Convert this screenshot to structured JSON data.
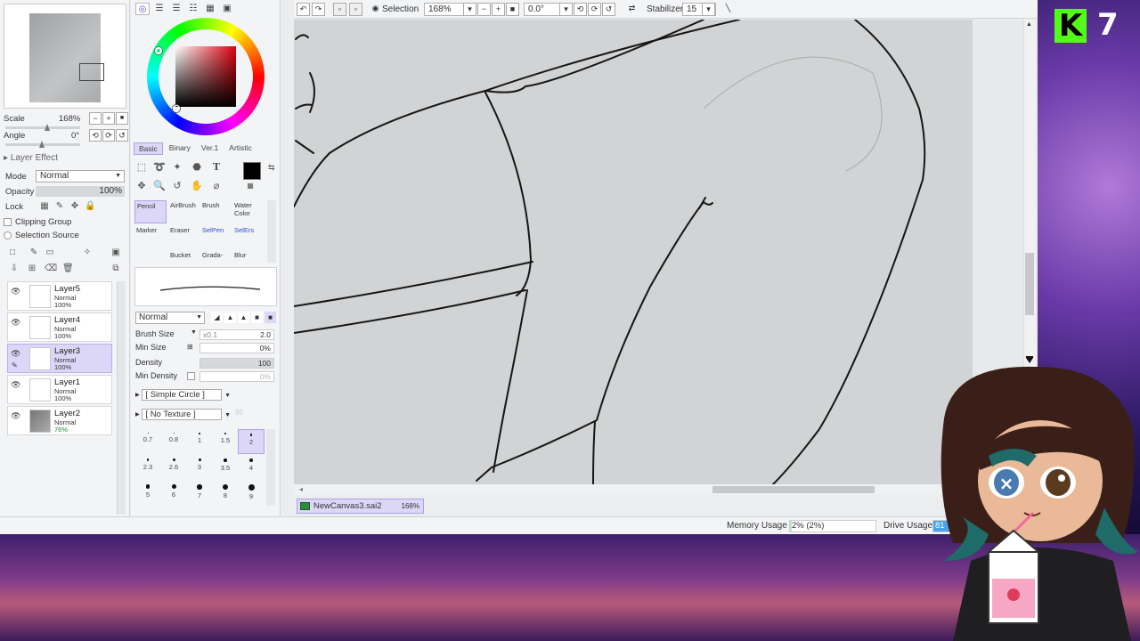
{
  "navigator": {
    "scale_label": "Scale",
    "scale_value": "168%",
    "angle_label": "Angle",
    "angle_value": "0°"
  },
  "layer_panel": {
    "effect_label": "Layer Effect",
    "mode_label": "Mode",
    "mode_value": "Normal",
    "opacity_label": "Opacity",
    "opacity_value": "100%",
    "lock_label": "Lock",
    "clipping_group": "Clipping Group",
    "selection_source": "Selection Source",
    "layers": [
      {
        "name": "Layer5",
        "mode": "Normal",
        "opacity": "100%"
      },
      {
        "name": "Layer4",
        "mode": "Normal",
        "opacity": "100%"
      },
      {
        "name": "Layer3",
        "mode": "Normal",
        "opacity": "100%"
      },
      {
        "name": "Layer1",
        "mode": "Normal",
        "opacity": "100%"
      },
      {
        "name": "Layer2",
        "mode": "Normal",
        "opacity": "76%"
      }
    ],
    "selected_index": 2
  },
  "color_tabs": [
    "Basic",
    "Binary",
    "Ver.1",
    "Artistic"
  ],
  "brushes": [
    {
      "name": "Pencil"
    },
    {
      "name": "AirBrush"
    },
    {
      "name": "Brush"
    },
    {
      "name": "Water Color"
    },
    {
      "name": "Marker"
    },
    {
      "name": "Eraser"
    },
    {
      "name": "SelPen"
    },
    {
      "name": "SelErs"
    },
    {
      "name": ""
    },
    {
      "name": "Bucket"
    },
    {
      "name": "Grada-"
    },
    {
      "name": "Blur"
    }
  ],
  "brush_props": {
    "blend_mode": "Normal",
    "size_label": "Brush Size",
    "size_mult": "x0.1",
    "size_value": "2.0",
    "min_size_label": "Min Size",
    "min_size_value": "0%",
    "density_label": "Density",
    "density_value": "100",
    "min_density_label": "Min Density",
    "min_density_value": "0%",
    "shape": "[ Simple Circle ]",
    "texture": "[ No Texture ]",
    "texture_value": "95"
  },
  "brush_sizes": [
    "0.7",
    "0.8",
    "1",
    "1.5",
    "2",
    "2.3",
    "2.6",
    "3",
    "3.5",
    "4",
    "5",
    "6",
    "7",
    "8",
    "9"
  ],
  "toolbar": {
    "selection_label": "Selection",
    "zoom_value": "168%",
    "angle_value": "0.0°",
    "stabilizer_label": "Stabilizer",
    "stabilizer_value": "15"
  },
  "document": {
    "name": "NewCanvas3.sai2",
    "zoom": "168%"
  },
  "status": {
    "memory_label": "Memory Usage",
    "memory_value": "2% (2%)",
    "memory_fraction": 0.02,
    "drive_label": "Drive Usage",
    "drive_value": "81"
  },
  "overlay": {
    "badge_letter": "K",
    "count": "7"
  },
  "colors": {
    "accent": "#dcd7f7",
    "kick_green": "#53fc18"
  }
}
